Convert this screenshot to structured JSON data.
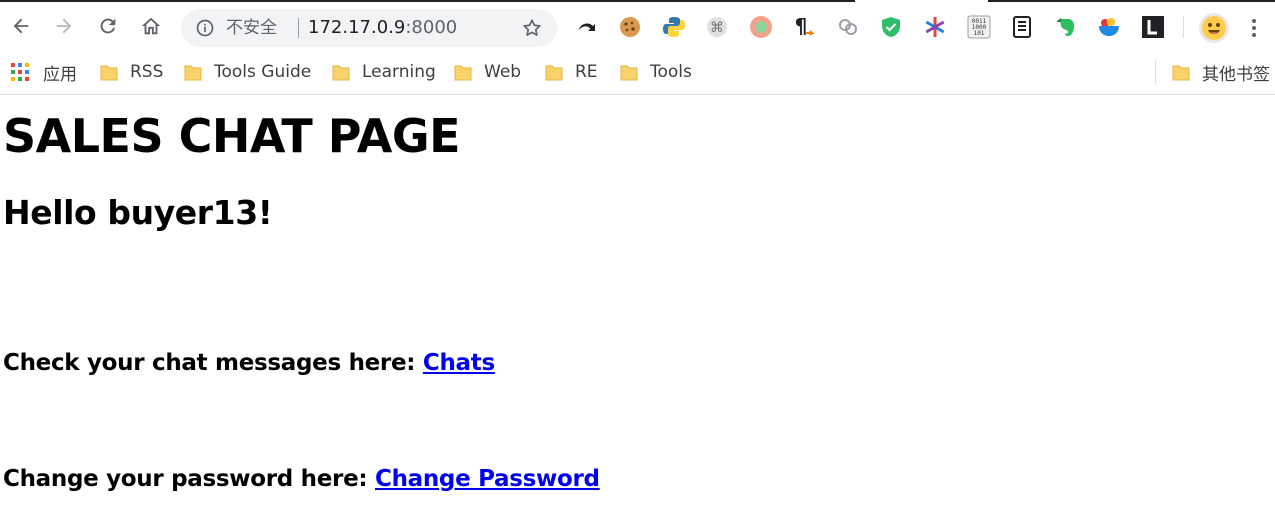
{
  "browser": {
    "security_label": "不安全",
    "url_host": "172.17.0.9",
    "url_port": ":8000",
    "nav_icons": [
      "back-arrow-icon",
      "forward-arrow-icon",
      "reload-icon",
      "home-icon"
    ],
    "extensions": [
      "undo-arrow-extension-icon",
      "cookie-extension-icon",
      "python-extension-icon",
      "command-key-extension-icon",
      "record-extension-icon",
      "pilcrow-extension-icon",
      "link-chain-extension-icon",
      "shield-check-extension-icon",
      "asterisk-color-extension-icon",
      "binary-extension-icon",
      "document-extension-icon",
      "evernote-extension-icon",
      "bowl-extension-icon",
      "letter-l-extension-icon"
    ],
    "accent": "#1a73e8"
  },
  "bookmarks": {
    "apps_label": "应用",
    "items": [
      {
        "label": "RSS"
      },
      {
        "label": "Tools Guide"
      },
      {
        "label": "Learning"
      },
      {
        "label": "Web"
      },
      {
        "label": "RE"
      },
      {
        "label": "Tools"
      }
    ],
    "other_label": "其他书签",
    "folder_color": "#f9d26b"
  },
  "page": {
    "title": "SALES CHAT PAGE",
    "greeting": "Hello buyer13!",
    "chat_prompt": "Check your chat messages here: ",
    "chat_link": "Chats",
    "password_prompt": "Change your password here: ",
    "password_link": "Change Password",
    "link_color": "#0000ee"
  }
}
